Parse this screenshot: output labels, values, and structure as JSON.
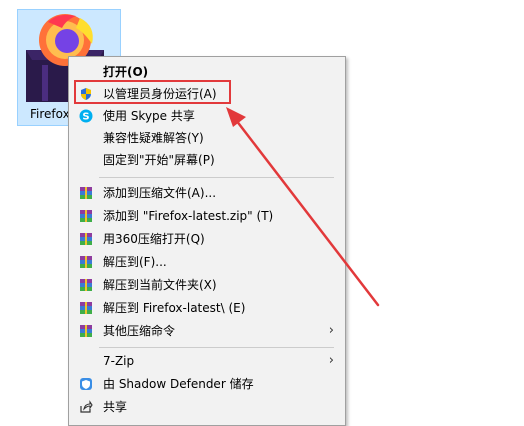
{
  "desktop_icon": {
    "label": "Firefox"
  },
  "menu": {
    "items": [
      {
        "label": "打开(O)",
        "icon": "none",
        "bold": true
      },
      {
        "label": "以管理员身份运行(A)",
        "icon": "uac-shield-icon"
      },
      {
        "label": "使用 Skype 共享",
        "icon": "skype-icon"
      },
      {
        "label": "兼容性疑难解答(Y)",
        "icon": "none"
      },
      {
        "label": "固定到\"开始\"屏幕(P)",
        "icon": "none"
      },
      {
        "label": "添加到压缩文件(A)...",
        "icon": "winrar-icon"
      },
      {
        "label": "添加到 \"Firefox-latest.zip\" (T)",
        "icon": "winrar-icon"
      },
      {
        "label": "用360压缩打开(Q)",
        "icon": "winrar-icon"
      },
      {
        "label": "解压到(F)...",
        "icon": "winrar-icon"
      },
      {
        "label": "解压到当前文件夹(X)",
        "icon": "winrar-icon"
      },
      {
        "label": "解压到 Firefox-latest\\ (E)",
        "icon": "winrar-icon"
      },
      {
        "label": "其他压缩命令",
        "icon": "winrar-icon",
        "submenu": true
      },
      {
        "label": "7-Zip",
        "icon": "none",
        "submenu": true
      },
      {
        "label": "由 Shadow Defender 储存",
        "icon": "shadow-defender-icon"
      },
      {
        "label": "共享",
        "icon": "share-icon"
      }
    ],
    "submenu_arrow": "›"
  },
  "annotation": {
    "highlight_color": "#e2393b"
  }
}
